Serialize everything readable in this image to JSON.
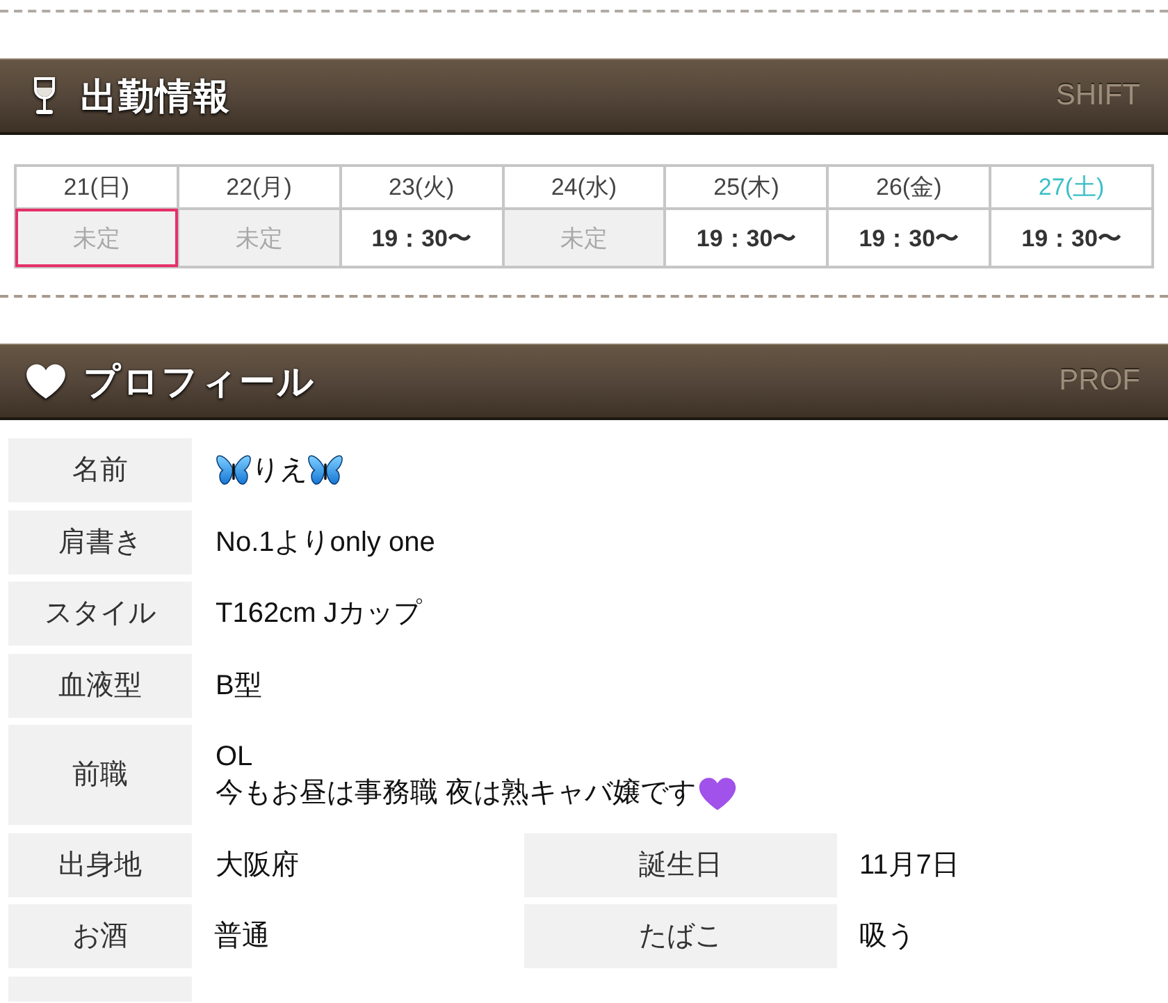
{
  "shift_section": {
    "title": "出勤情報",
    "subtitle": "SHIFT",
    "days": [
      {
        "date": "21(日)",
        "color": "#444444",
        "today": true,
        "kind": "undecided",
        "shift": "未定"
      },
      {
        "date": "22(月)",
        "color": "#444444",
        "today": false,
        "kind": "undecided",
        "shift": "未定"
      },
      {
        "date": "23(火)",
        "color": "#444444",
        "today": false,
        "kind": "time",
        "shift": "19：30〜"
      },
      {
        "date": "24(水)",
        "color": "#444444",
        "today": false,
        "kind": "undecided",
        "shift": "未定"
      },
      {
        "date": "25(木)",
        "color": "#444444",
        "today": false,
        "kind": "time",
        "shift": "19：30〜"
      },
      {
        "date": "26(金)",
        "color": "#444444",
        "today": false,
        "kind": "time",
        "shift": "19：30〜"
      },
      {
        "date": "27(土)",
        "color": "#3bbfc6",
        "today": false,
        "kind": "time",
        "shift": "19：30〜"
      }
    ]
  },
  "profile_section": {
    "title": "プロフィール",
    "subtitle": "PROF",
    "rows": [
      {
        "kind": "name",
        "fields": [
          {
            "label": "名前",
            "value": "りえ"
          }
        ]
      },
      {
        "kind": "plain",
        "fields": [
          {
            "label": "肩書き",
            "value": "No.1よりonly one"
          }
        ]
      },
      {
        "kind": "plain",
        "fields": [
          {
            "label": "スタイル",
            "value": "T162cm Jカップ"
          }
        ]
      },
      {
        "kind": "plain",
        "fields": [
          {
            "label": "血液型",
            "value": "B型"
          }
        ]
      },
      {
        "kind": "note",
        "fields": [
          {
            "label": "前職",
            "lines": [
              "OL",
              "今もお昼は事務職 夜は熟キャバ嬢です"
            ]
          }
        ]
      },
      {
        "kind": "pair",
        "fields": [
          {
            "label": "出身地",
            "value": "大阪府"
          },
          {
            "label": "誕生日",
            "value": "11月7日"
          }
        ]
      },
      {
        "kind": "pair",
        "fields": [
          {
            "label": "お酒",
            "value": "普通"
          },
          {
            "label": "たばこ",
            "value": "吸う"
          }
        ]
      },
      {
        "kind": "clipped"
      }
    ]
  }
}
